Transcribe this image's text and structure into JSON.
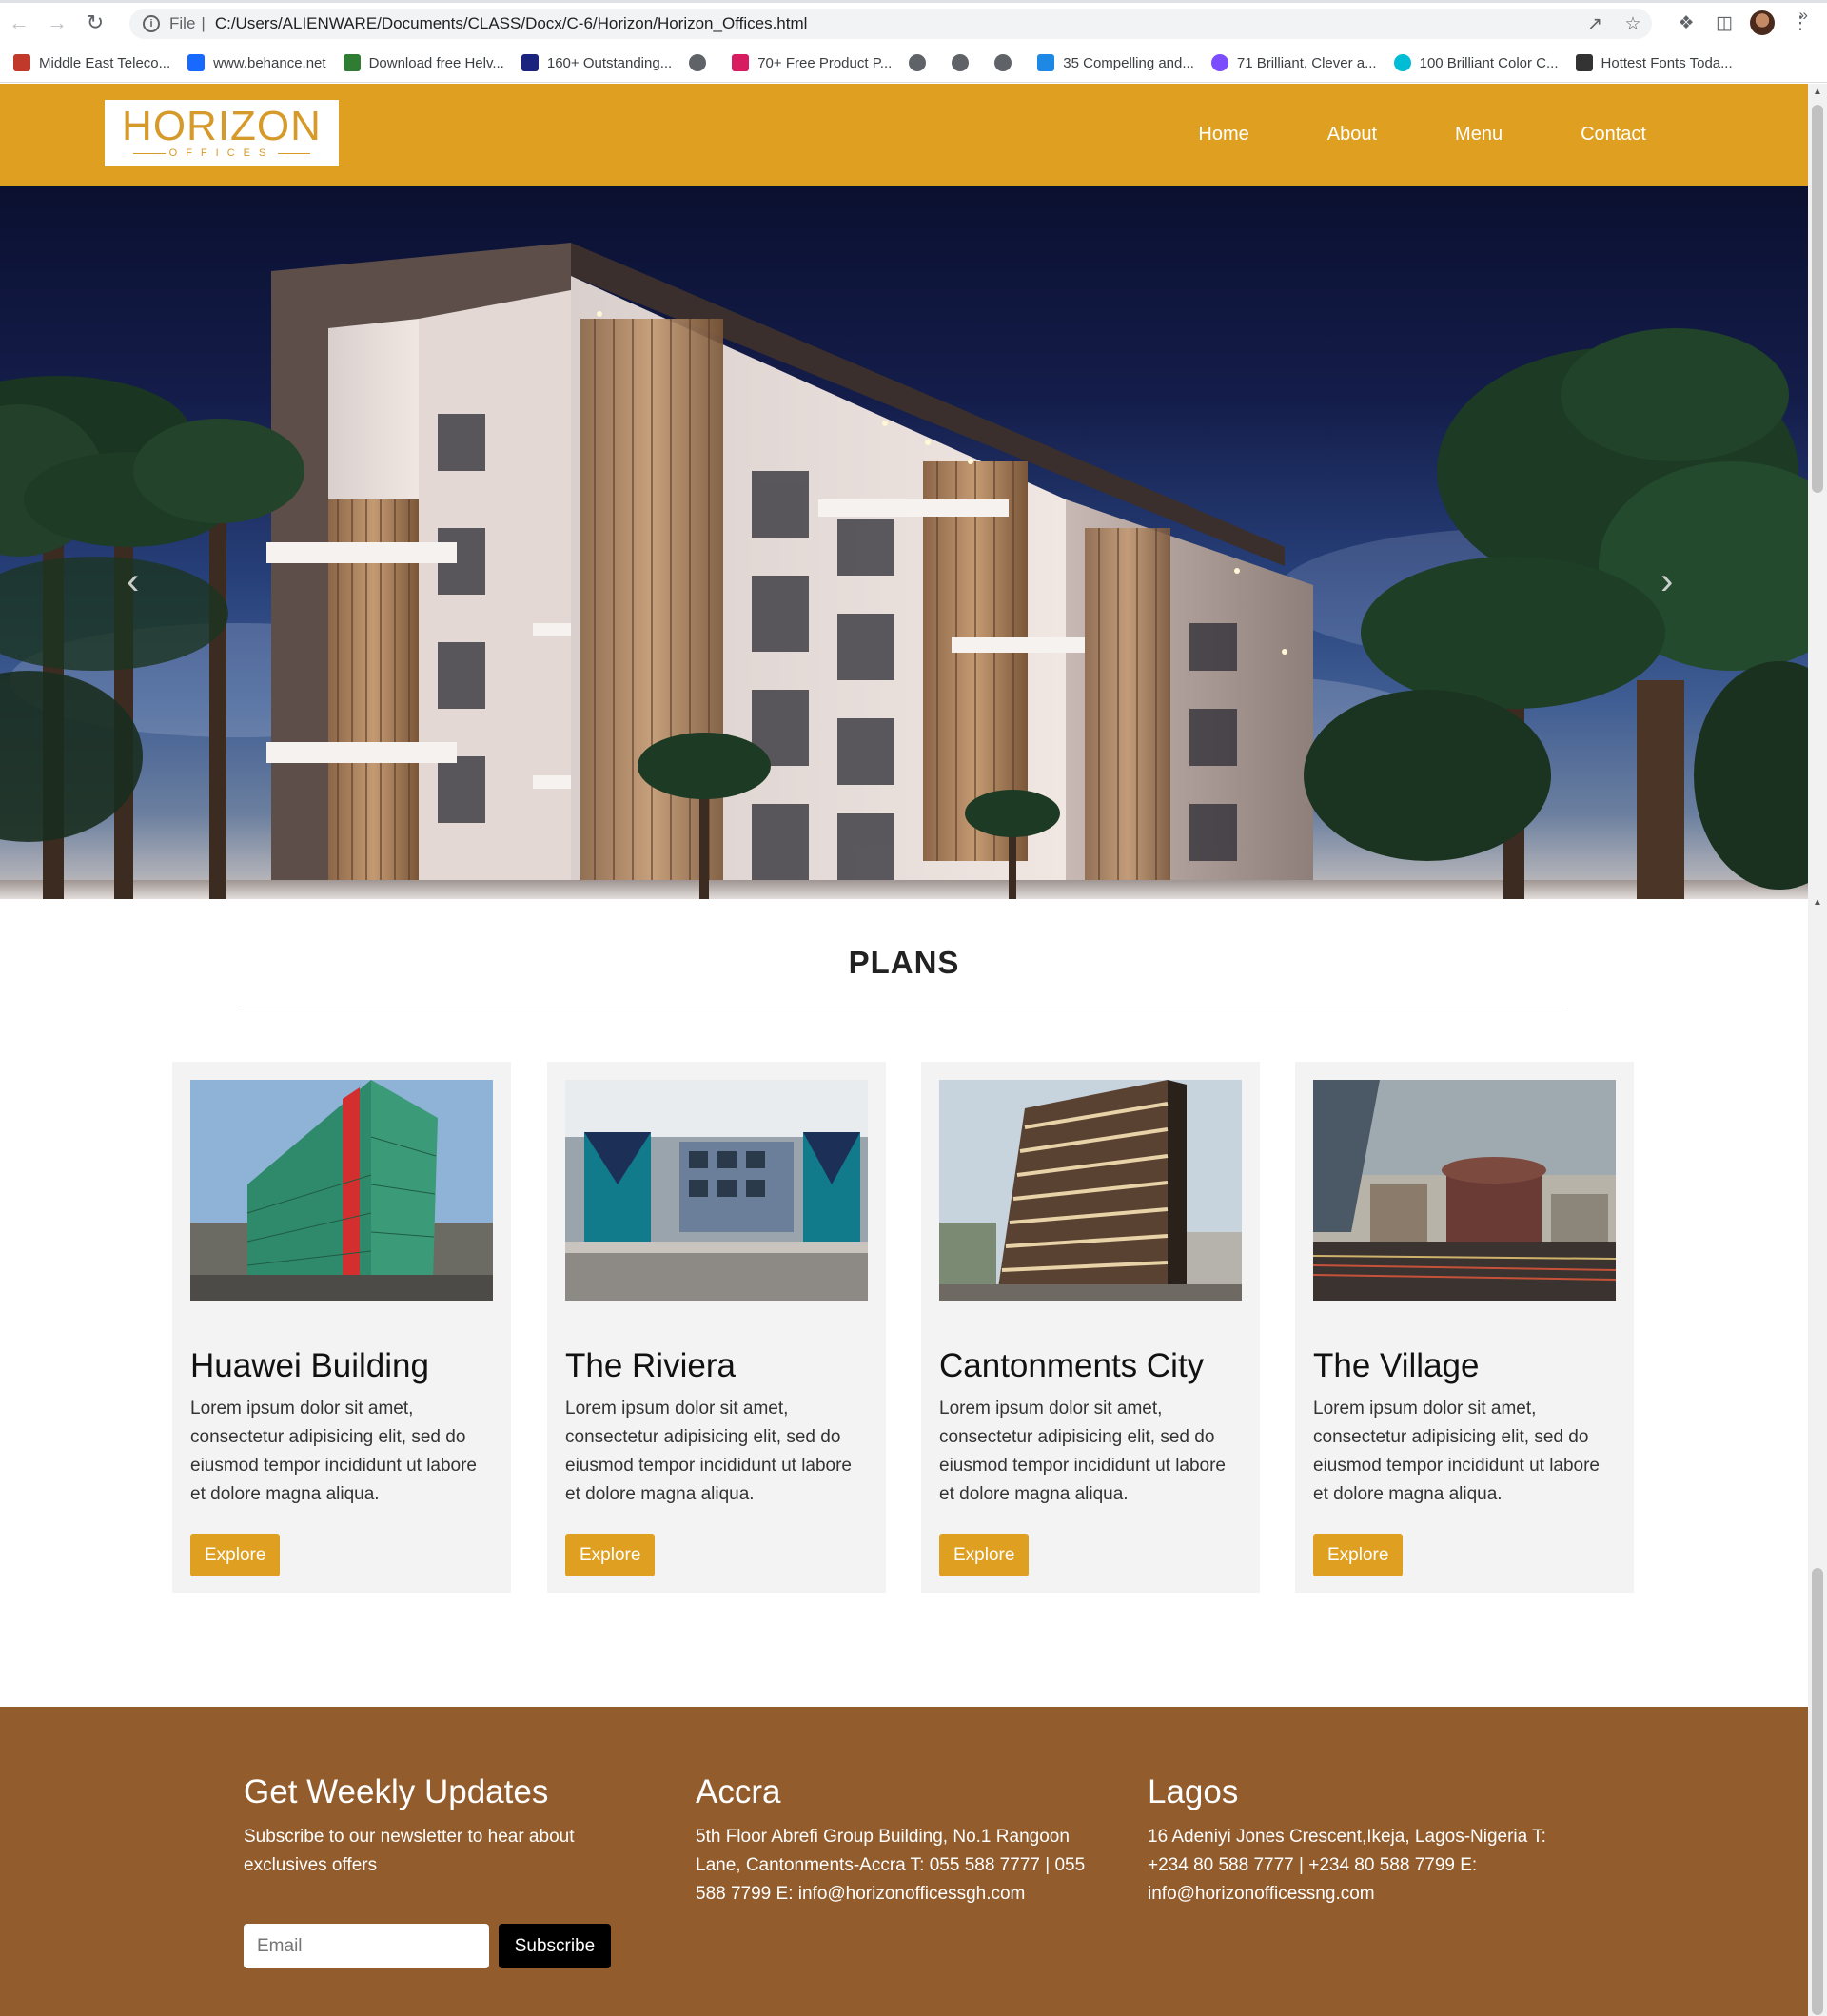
{
  "browser": {
    "scheme": "File",
    "url": "C:/Users/ALIENWARE/Documents/CLASS/Docx/C-6/Horizon/Horizon_Offices.html",
    "bookmarks": [
      {
        "label": "Middle East Teleco...",
        "icon": "telecom-icon",
        "color": "#c0392b"
      },
      {
        "label": "www.behance.net",
        "icon": "behance-icon",
        "color": "#1769ff"
      },
      {
        "label": "Download free Helv...",
        "icon": "check-icon",
        "color": "#2e7d32"
      },
      {
        "label": "160+ Outstanding...",
        "icon": "hd-icon",
        "color": "#1a237e"
      },
      {
        "label": "",
        "icon": "globe-icon",
        "color": "#5f6368"
      },
      {
        "label": "70+ Free Product P...",
        "icon": "t-icon",
        "color": "#d81b60"
      },
      {
        "label": "",
        "icon": "globe-icon",
        "color": "#5f6368"
      },
      {
        "label": "",
        "icon": "globe-icon",
        "color": "#5f6368"
      },
      {
        "label": "",
        "icon": "globe-icon",
        "color": "#5f6368"
      },
      {
        "label": "35 Compelling and...",
        "icon": "p-icon",
        "color": "#1e88e5"
      },
      {
        "label": "71 Brilliant, Clever a...",
        "icon": "c-icon",
        "color": "#7c4dff"
      },
      {
        "label": "100 Brilliant Color C...",
        "icon": "c-icon",
        "color": "#00bcd4"
      },
      {
        "label": "Hottest Fonts Toda...",
        "icon": "fonts-icon",
        "color": "#333333"
      }
    ],
    "more": "»"
  },
  "site": {
    "logo_main": "HORIZON",
    "logo_sub": "OFFICES",
    "nav": [
      "Home",
      "About",
      "Menu",
      "Contact"
    ],
    "accent_color": "#dfa021",
    "footer_color": "#935c2d"
  },
  "hero": {
    "prev_arrow": "‹",
    "next_arrow": "›",
    "slide_count": 3,
    "active_slide": 2
  },
  "plans": {
    "title": "PLANS",
    "cards": [
      {
        "title": "Huawei Building",
        "text": "Lorem ipsum dolor sit amet, consectetur adipisicing elit, sed do eiusmod tempor incididunt ut labore et dolore magna aliqua.",
        "button": "Explore"
      },
      {
        "title": "The Riviera",
        "text": "Lorem ipsum dolor sit amet, consectetur adipisicing elit, sed do eiusmod tempor incididunt ut labore et dolore magna aliqua.",
        "button": "Explore"
      },
      {
        "title": "Cantonments City",
        "text": "Lorem ipsum dolor sit amet, consectetur adipisicing elit, sed do eiusmod tempor incididunt ut labore et dolore magna aliqua.",
        "button": "Explore"
      },
      {
        "title": "The Village",
        "text": "Lorem ipsum dolor sit amet, consectetur adipisicing elit, sed do eiusmod tempor incididunt ut labore et dolore magna aliqua.",
        "button": "Explore"
      }
    ]
  },
  "footer": {
    "newsletter_title": "Get Weekly Updates",
    "newsletter_text": "Subscribe to our newsletter to hear about exclusives offers",
    "email_placeholder": "Email",
    "subscribe_label": "Subscribe",
    "accra_title": "Accra",
    "accra_text": "5th Floor Abrefi Group Building, No.1 Rangoon Lane, Cantonments-Accra T: 055 588 7777 | 055 588 7799 E: info@horizonofficessgh.com",
    "lagos_title": "Lagos",
    "lagos_text": "16 Adeniyi Jones Crescent,Ikeja, Lagos-Nigeria T: +234 80 588 7777 | +234 80 588 7799 E: info@horizonofficessng.com"
  }
}
